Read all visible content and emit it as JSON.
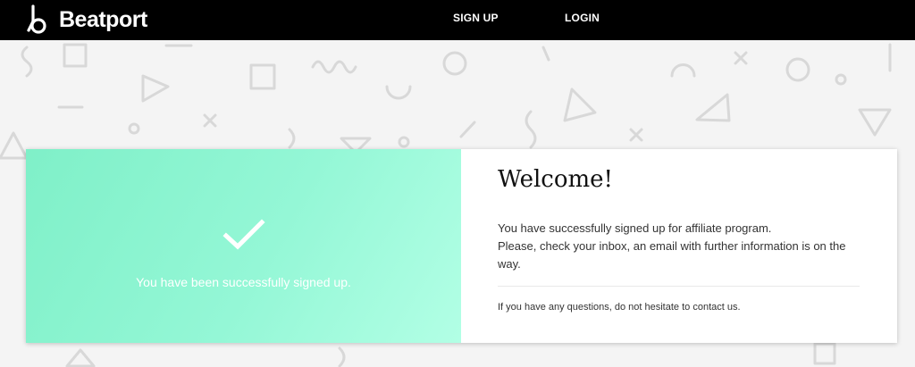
{
  "header": {
    "logo_text": "Beatport",
    "nav": {
      "signup_label": "SIGN UP",
      "login_label": "LOGIN"
    }
  },
  "card": {
    "success_message": "You have been successfully signed up.",
    "welcome_title": "Welcome!",
    "body_line1": "You have successfully signed up for affiliate program.",
    "body_line2": "Please, check your inbox, an email with further information is on the way.",
    "footnote_prefix": "If you have any questions, do not hesitate to ",
    "contact_link": "contact us",
    "footnote_suffix": "."
  },
  "colors": {
    "header_bg": "#000000",
    "accent_green": "#94f7d6",
    "page_bg": "#f4f4f4"
  },
  "icons": [
    "beatport-logo-icon",
    "checkmark-icon"
  ]
}
